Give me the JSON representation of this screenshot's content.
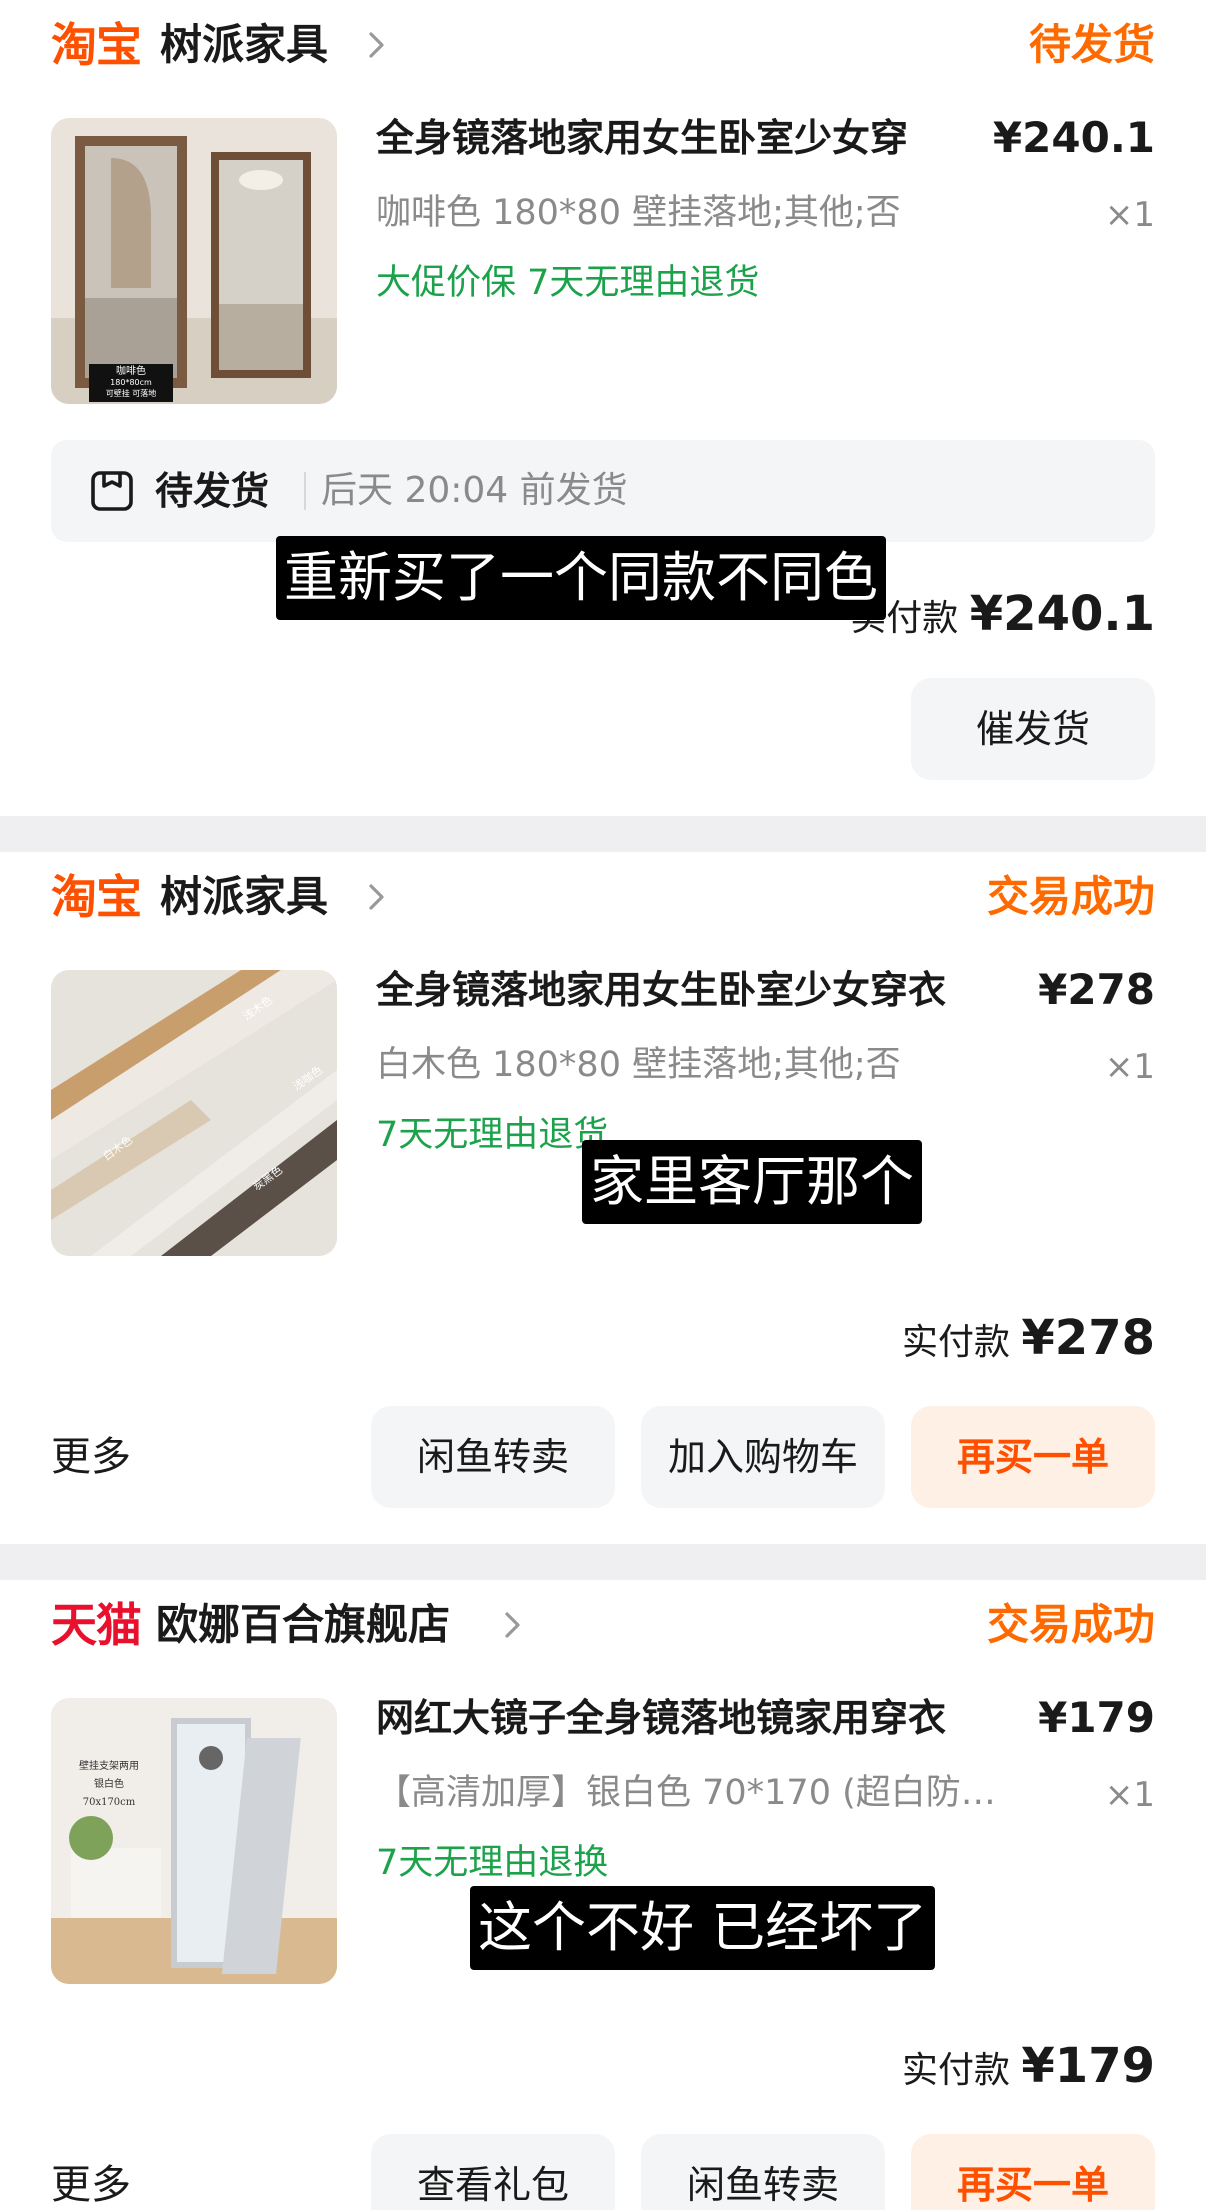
{
  "orders": [
    {
      "platform": "淘宝",
      "shop": "树派家具",
      "status": "待发货",
      "title": "全身镜落地家用女生卧室少女穿",
      "price": "¥240.1",
      "sku": "咖啡色 180*80 壁挂落地;其他;否",
      "qty": "×1",
      "tags": "大促价保 7天无理由退货",
      "thumb_label": "咖啡色",
      "thumb_sub": "180*80cm",
      "thumb_sub2": "可壁挂 可落地",
      "shipping": {
        "status": "待发货",
        "time": "后天 20:04 前发货"
      },
      "paid_label": "实付款",
      "paid_amount": "¥240.1",
      "buttons": [
        "催发货"
      ]
    },
    {
      "platform": "淘宝",
      "shop": "树派家具",
      "status": "交易成功",
      "title": "全身镜落地家用女生卧室少女穿衣",
      "price": "¥278",
      "sku": "白木色 180*80 壁挂落地;其他;否",
      "qty": "×1",
      "tags": "7天无理由退货",
      "thumb_labels": [
        "浅木色",
        "浅咖色",
        "白木色",
        "炭黑色"
      ],
      "paid_label": "实付款",
      "paid_amount": "¥278",
      "more": "更多",
      "buttons": [
        "闲鱼转卖",
        "加入购物车",
        "再买一单"
      ]
    },
    {
      "platform": "天猫",
      "shop": "欧娜百合旗舰店",
      "status": "交易成功",
      "title": "网红大镜子全身镜落地镜家用穿衣",
      "price": "¥179",
      "sku": "【高清加厚】银白色 70*170 (超白防…",
      "qty": "×1",
      "tags": "7天无理由退换",
      "thumb_text": [
        "壁挂支架两用",
        "银白色",
        "70x170cm"
      ],
      "paid_label": "实付款",
      "paid_amount": "¥179",
      "more": "更多",
      "buttons": [
        "查看礼包",
        "闲鱼转卖",
        "再买一单"
      ]
    }
  ],
  "captions": [
    "重新买了一个同款不同色",
    "家里客厅那个",
    "这个不好 已经坏了"
  ],
  "colors": {
    "taobao": "#ff5000",
    "tmall": "#e8102d",
    "status": "#ff6a00",
    "green_tag": "#1ca24b"
  }
}
